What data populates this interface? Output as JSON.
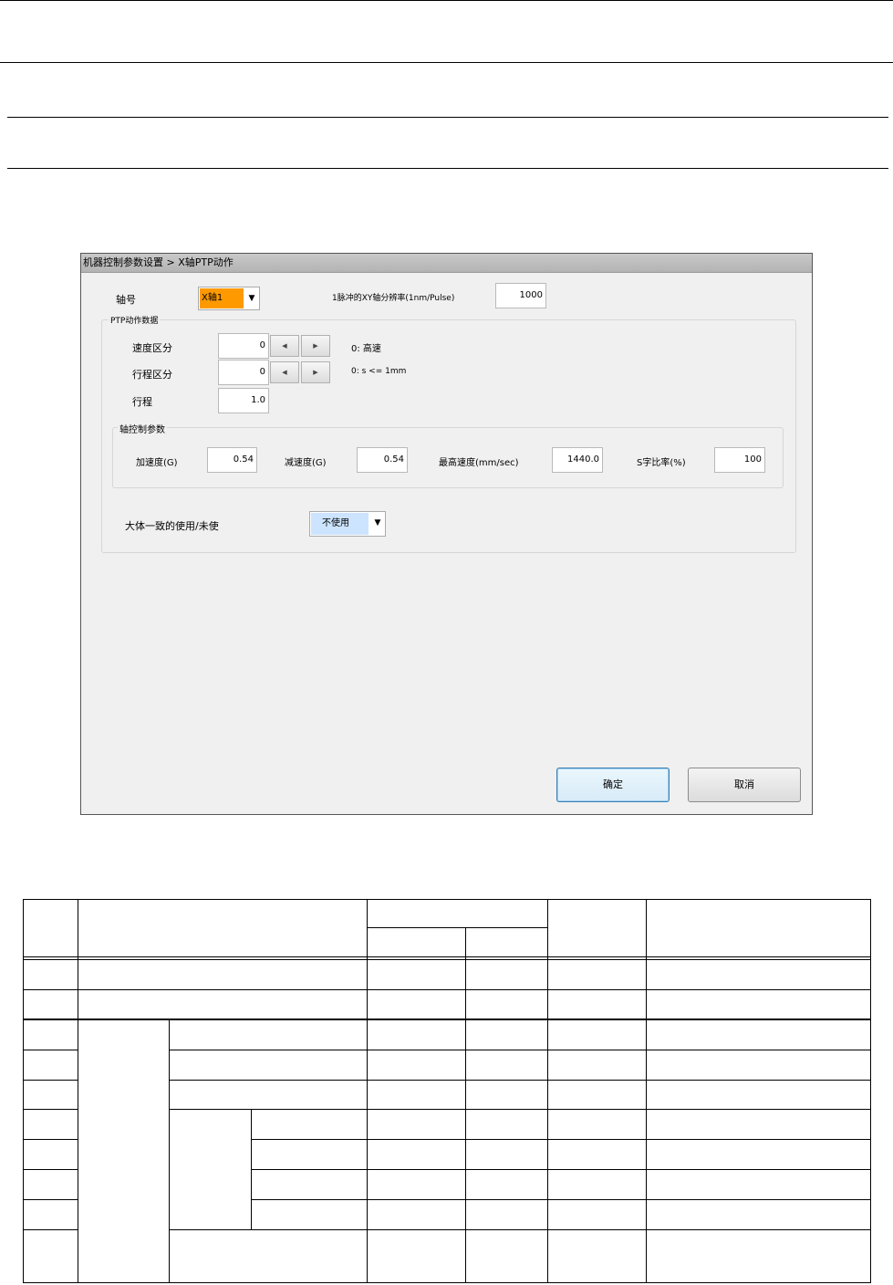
{
  "dialog": {
    "title": "机器控制参数设置 > X轴PTP动作",
    "axis_label": "轴号",
    "axis_value": "X轴1",
    "resolution_label": "1脉冲的XY轴分辨率(1nm/Pulse)",
    "resolution_value": "1000",
    "ptp_group_label": "PTP动作数据",
    "speed_class_label": "速度区分",
    "speed_class_value": "0",
    "speed_class_note": "0: 高速",
    "stroke_class_label": "行程区分",
    "stroke_class_value": "0",
    "stroke_class_note": "0: s <= 1mm",
    "stroke_label": "行程",
    "stroke_value": "1.0",
    "axis_ctrl_group_label": "轴控制参数",
    "accel_label": "加速度(G)",
    "accel_value": "0.54",
    "decel_label": "减速度(G)",
    "decel_value": "0.54",
    "max_speed_label": "最高速度(mm/sec)",
    "max_speed_value": "1440.0",
    "s_ratio_label": "S字比率(%)",
    "s_ratio_value": "100",
    "approx_label": "大体一致的使用/未使",
    "approx_value": "不使用",
    "ok_label": "确定",
    "cancel_label": "取消",
    "spin_left_icon": "triangle-left",
    "spin_right_icon": "triangle-right",
    "dropdown_icon": "triangle-down",
    "axis_combo_color": "#ff9900",
    "approx_combo_color": "#cce4ff"
  }
}
